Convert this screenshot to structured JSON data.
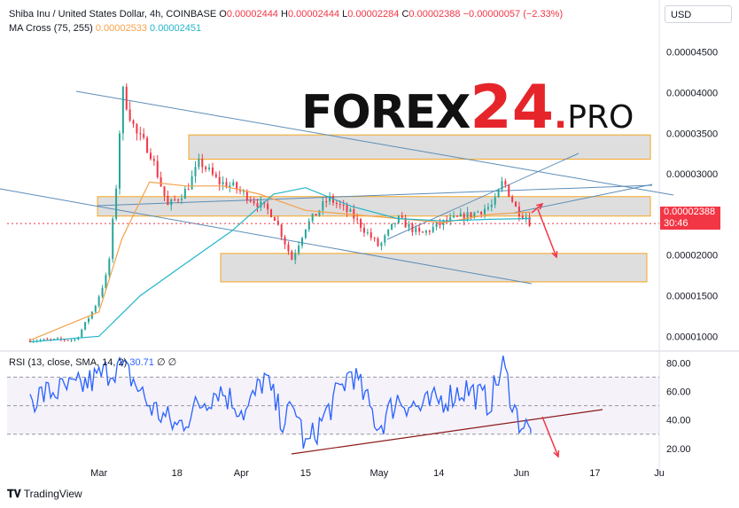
{
  "header": {
    "symbol": "Shiba Inu / United States Dollar, 4h, COINBASE",
    "o_label": "O",
    "o_value": "0.00002444",
    "h_label": "H",
    "h_value": "0.00002444",
    "l_label": "L",
    "l_value": "0.00002284",
    "c_label": "C",
    "c_value": "0.00002388",
    "change": "−0.00000057 (−2.33%)",
    "ma_label": "MA Cross (75, 255)",
    "ma_fast": "0.00002533",
    "ma_slow": "0.00002451",
    "currency": "USD"
  },
  "price_tag": {
    "price": "0.00002388",
    "countdown": "30:46"
  },
  "rsi_header": {
    "label": "RSI (13, close, SMA, 14, 2)",
    "value": "30.71",
    "extra": "∅ ∅"
  },
  "logo": {
    "word": "FOREX",
    "num": "24",
    "dot": ".",
    "tld": "PRO"
  },
  "footer": {
    "brand": "TradingView"
  },
  "colors": {
    "up": "#26a69a",
    "down": "#f23645",
    "ma_fast": "#f5a14b",
    "ma_slow": "#22b5c9",
    "rsi": "#2962ff",
    "zone_fill": "#d6d6d6",
    "zone_border": "#f5a623",
    "trend": "#5b8db8"
  },
  "chart_data": [
    {
      "type": "candlestick",
      "title": "Shiba Inu / United States Dollar, 4h, COINBASE",
      "x_ticks": [
        "Mar",
        "18",
        "Apr",
        "15",
        "May",
        "14",
        "Jun",
        "17",
        "Ju"
      ],
      "y_ticks": [
        1e-05,
        1.5e-05,
        2e-05,
        2.5e-05,
        3e-05,
        3.5e-05,
        4e-05,
        4.5e-05
      ],
      "y_tick_labels": [
        "0.00001000",
        "0.00001500",
        "0.00002000",
        "0.00002500",
        "0.00003000",
        "0.00003500",
        "0.00004000",
        "0.00004500"
      ],
      "ylim": [
        8.5e-06,
        4.65e-05
      ],
      "close_path_dates": [
        "2024-02-15",
        "2024-02-25",
        "2024-02-29",
        "2024-03-03",
        "2024-03-05",
        "2024-03-06",
        "2024-03-09",
        "2024-03-12",
        "2024-03-16",
        "2024-03-20",
        "2024-03-23",
        "2024-03-27",
        "2024-03-30",
        "2024-04-03",
        "2024-04-08",
        "2024-04-12",
        "2024-04-15",
        "2024-04-20",
        "2024-04-25",
        "2024-05-01",
        "2024-05-05",
        "2024-05-10",
        "2024-05-15",
        "2024-05-21",
        "2024-05-26",
        "2024-05-28",
        "2024-05-31",
        "2024-06-02",
        "2024-06-03"
      ],
      "close_path": [
        9.5e-06,
        9.6e-06,
        1.35e-05,
        1.8e-05,
        3e-05,
        4.05e-05,
        3.5e-05,
        3.3e-05,
        2.6e-05,
        2.8e-05,
        3.15e-05,
        2.9e-05,
        2.85e-05,
        2.7e-05,
        2.5e-05,
        1.95e-05,
        2.35e-05,
        2.7e-05,
        2.5e-05,
        2.1e-05,
        2.45e-05,
        2.25e-05,
        2.4e-05,
        2.5e-05,
        2.62e-05,
        2.92e-05,
        2.55e-05,
        2.48e-05,
        2.39e-05
      ],
      "series": [
        {
          "name": "MA Cross (75, 255)",
          "dates": [
            "2024-02-15",
            "2024-03-01",
            "2024-03-06",
            "2024-03-12",
            "2024-03-20",
            "2024-03-28",
            "2024-04-05",
            "2024-04-15",
            "2024-04-25",
            "2024-05-05",
            "2024-05-15",
            "2024-05-25",
            "2024-06-03"
          ],
          "values": [
            9.5e-06,
            1.3e-05,
            2.2e-05,
            2.9e-05,
            2.85e-05,
            2.85e-05,
            2.75e-05,
            2.55e-05,
            2.5e-05,
            2.45e-05,
            2.4e-05,
            2.5e-05,
            2.53e-05
          ]
        },
        {
          "name": "MA Cross (75, 255) slow",
          "dates": [
            "2024-02-15",
            "2024-03-01",
            "2024-03-10",
            "2024-03-20",
            "2024-03-30",
            "2024-04-08",
            "2024-04-15",
            "2024-04-25",
            "2024-05-05",
            "2024-05-15",
            "2024-05-25",
            "2024-06-03"
          ],
          "values": [
            9.3e-06,
            1e-05,
            1.5e-05,
            1.9e-05,
            2.3e-05,
            2.75e-05,
            2.83e-05,
            2.6e-05,
            2.45e-05,
            2.42e-05,
            2.44e-05,
            2.45e-05
          ]
        }
      ],
      "zones": [
        {
          "from": 3.18e-05,
          "to": 3.48e-05
        },
        {
          "from": 2.48e-05,
          "to": 2.72e-05
        },
        {
          "from": 1.67e-05,
          "to": 2.02e-05
        }
      ],
      "last_price": 2.388e-05
    },
    {
      "type": "line",
      "title": "RSI (13, close, SMA, 14, 2)",
      "y_ticks": [
        20,
        40,
        60,
        80
      ],
      "y_tick_labels": [
        "20.00",
        "40.00",
        "60.00",
        "80.00"
      ],
      "ylim": [
        10,
        87
      ],
      "band": [
        30,
        70
      ],
      "dates": [
        "2024-02-15",
        "2024-02-20",
        "2024-02-25",
        "2024-03-01",
        "2024-03-05",
        "2024-03-08",
        "2024-03-12",
        "2024-03-18",
        "2024-03-22",
        "2024-03-27",
        "2024-04-02",
        "2024-04-06",
        "2024-04-10",
        "2024-04-13",
        "2024-04-15",
        "2024-04-22",
        "2024-04-25",
        "2024-05-01",
        "2024-05-05",
        "2024-05-10",
        "2024-05-15",
        "2024-05-20",
        "2024-05-25",
        "2024-05-28",
        "2024-05-31",
        "2024-06-03"
      ],
      "values": [
        55,
        60,
        62,
        70,
        78,
        70,
        50,
        35,
        48,
        62,
        45,
        70,
        40,
        48,
        20,
        58,
        75,
        35,
        55,
        48,
        55,
        62,
        52,
        78,
        42,
        30.71
      ],
      "last_value": 30.71
    }
  ]
}
